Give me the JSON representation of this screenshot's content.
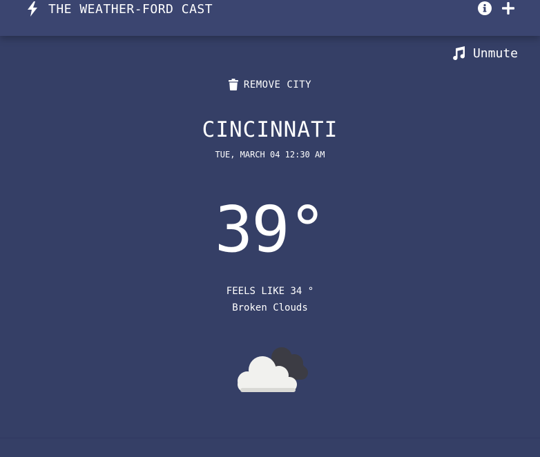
{
  "header": {
    "title": "THE WEATHER-FORD CAST",
    "brand_icon": "bolt-icon",
    "actions": [
      {
        "name": "info-icon"
      },
      {
        "name": "plus-icon"
      }
    ]
  },
  "sound": {
    "label": "Unmute",
    "icon": "music-note-icon"
  },
  "city_actions": {
    "remove_label": "REMOVE CITY",
    "remove_icon": "trash-icon"
  },
  "weather": {
    "city": "CINCINNATI",
    "datetime": "TUE, MARCH 04 12:30 AM",
    "temperature": "39°",
    "feels_like": "FEELS LIKE 34 °",
    "description": "Broken Clouds",
    "icon": "broken-clouds-icon"
  },
  "colors": {
    "background": "#353f66",
    "topbar": "#3b4570",
    "text": "#ffffff"
  }
}
